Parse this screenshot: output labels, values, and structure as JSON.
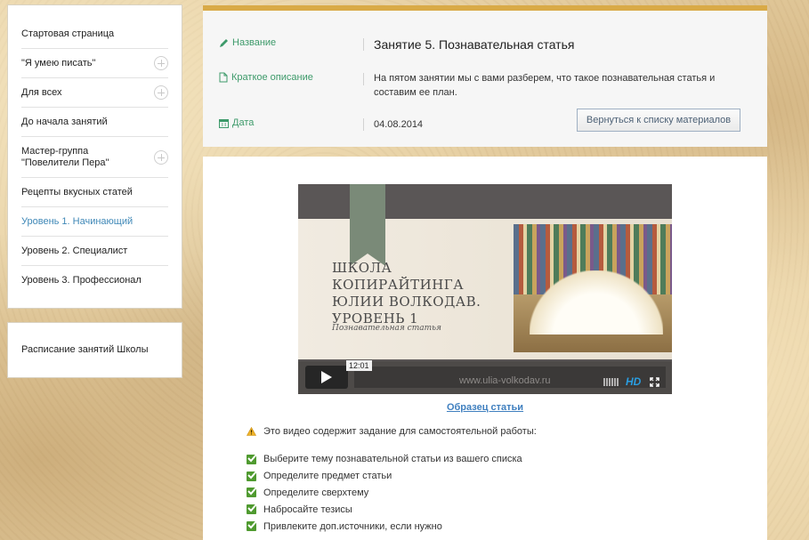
{
  "sidebar": {
    "items": [
      {
        "label": "Стартовая страница",
        "expandable": false,
        "active": false
      },
      {
        "label": "\"Я умею писать\"",
        "expandable": true,
        "active": false
      },
      {
        "label": "Для всех",
        "expandable": true,
        "active": false
      },
      {
        "label": "До начала занятий",
        "expandable": false,
        "active": false
      },
      {
        "label": "Мастер-группа \"Повелители Пера\"",
        "expandable": true,
        "active": false
      },
      {
        "label": "Рецепты вкусных статей",
        "expandable": false,
        "active": false
      },
      {
        "label": "Уровень 1. Начинающий",
        "expandable": false,
        "active": true
      },
      {
        "label": "Уровень 2. Специалист",
        "expandable": false,
        "active": false
      },
      {
        "label": "Уровень 3. Профессионал",
        "expandable": false,
        "active": false
      }
    ],
    "schedule_label": "Расписание занятий Школы"
  },
  "header": {
    "title_label": "Название",
    "title_value": "Занятие 5. Познавательная статья",
    "description_label": "Краткое описание",
    "description_value": "На пятом занятии мы с вами разберем, что такое познавательная статья и составим ее план.",
    "date_label": "Дата",
    "date_value": "04.08.2014",
    "back_button_label": "Вернуться к списку материалов"
  },
  "video": {
    "slide_title": "ШКОЛА КОПИРАЙТИНГА ЮЛИИ ВОЛКОДАВ. УРОВЕНЬ 1",
    "slide_subtitle": "Познавательная статья",
    "duration": "12:01",
    "watermark_url": "www.ulia-volkodav.ru",
    "hd_label": "HD"
  },
  "content": {
    "sample_link": "Образец статьи",
    "task_note": "Это видео содержит задание для самостоятельной работы:",
    "tasks": [
      "Выберите тему познавательной статьи из вашего списка",
      "Определите предмет статьи",
      "Определите сверхтему",
      "Набросайте тезисы",
      "Привлеките доп.источники, если нужно"
    ]
  },
  "colors": {
    "accent_bar": "#d9aa47",
    "label_green": "#3d9a6a",
    "active_link": "#3f88b7",
    "hd_blue": "#2a9de0"
  }
}
